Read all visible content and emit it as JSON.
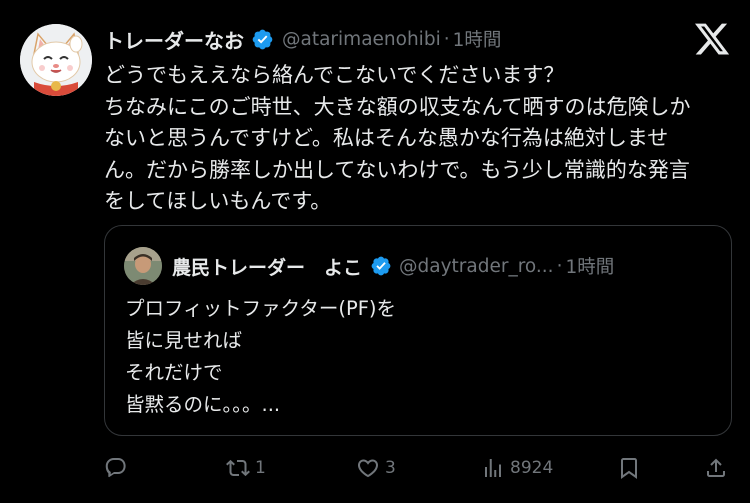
{
  "author": {
    "name": "トレーダーなお",
    "handle": "@atarimaenohibi",
    "separator": "·",
    "time": "1時間"
  },
  "tweet": {
    "lines": [
      "どうでもええなら絡んでこないでくださいます？",
      "ちなみにこのご時世、大きな額の収支なんて晒すのは危険しか",
      "ないと思うんですけど。私はそんな愚かな行為は絶対しませ",
      "ん。だから勝率しか出してないわけで。もう少し常識的な発言",
      "をしてほしいもんです。"
    ]
  },
  "quote": {
    "name": "農民トレーダー　よこ",
    "handle": "@daytrader_ro...",
    "separator": "·",
    "time": "1時間",
    "lines": [
      "プロフィットファクター(PF)を",
      "皆に見せれば",
      "それだけで",
      "皆黙るのに。。。..."
    ]
  },
  "actions": {
    "reply_count": "",
    "retweet_count": "1",
    "like_count": "3",
    "views_count": "8924"
  },
  "colors": {
    "background": "#000000",
    "text": "#e7e9ea",
    "muted": "#71767b",
    "verified": "#1d9bf0",
    "border": "#333639"
  },
  "icons": [
    "x-logo-icon",
    "verified-badge-icon",
    "reply-icon",
    "retweet-icon",
    "like-icon",
    "views-icon",
    "bookmark-icon",
    "share-icon"
  ]
}
